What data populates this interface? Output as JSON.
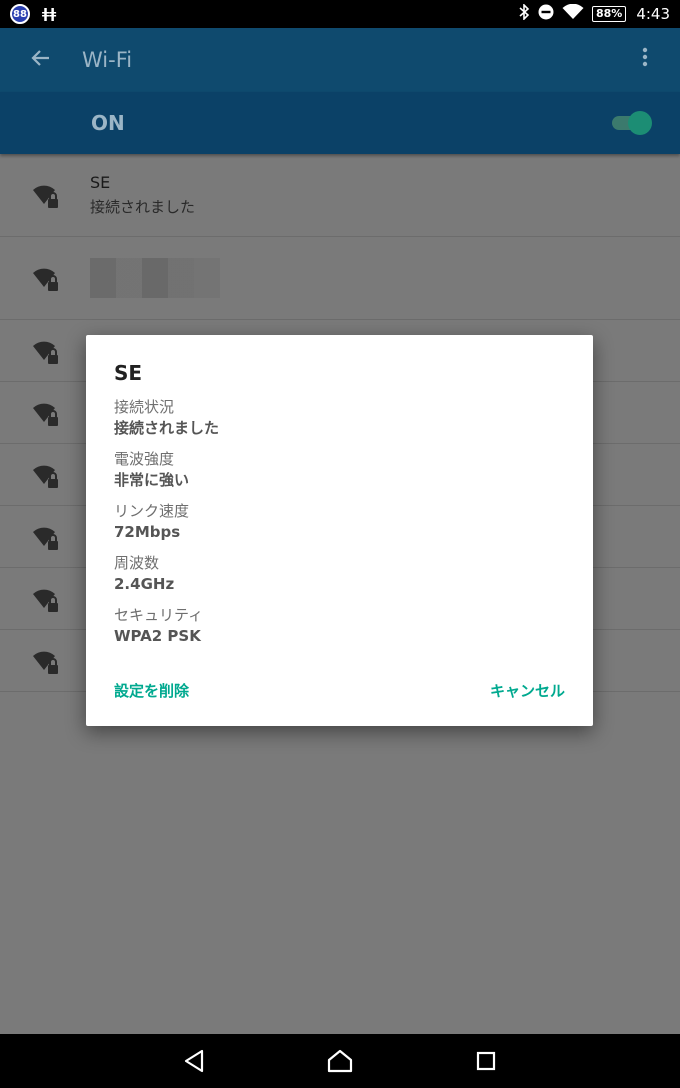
{
  "status_bar": {
    "badge": "88",
    "usb_label": "ǂǂ",
    "battery": "88%",
    "time": "4:43"
  },
  "app_bar": {
    "title": "Wi-Fi",
    "back_icon": "arrow-left-icon",
    "menu_icon": "more-vert-icon"
  },
  "wifi_switch": {
    "label": "ON",
    "enabled": true
  },
  "networks": [
    {
      "name": "SE",
      "status": "接続されました"
    }
  ],
  "dialog": {
    "title": "SE",
    "fields": [
      {
        "label": "接続状況",
        "value": "接続されました"
      },
      {
        "label": "電波強度",
        "value": "非常に強い"
      },
      {
        "label": "リンク速度",
        "value": "72Mbps"
      },
      {
        "label": "周波数",
        "value": "2.4GHz"
      },
      {
        "label": "セキュリティ",
        "value": "WPA2 PSK"
      }
    ],
    "forget_label": "設定を削除",
    "cancel_label": "キャンセル"
  },
  "colors": {
    "accent": "#00a98f",
    "app_bar": "#0f4a6e",
    "switch_bar": "#0b4167"
  }
}
